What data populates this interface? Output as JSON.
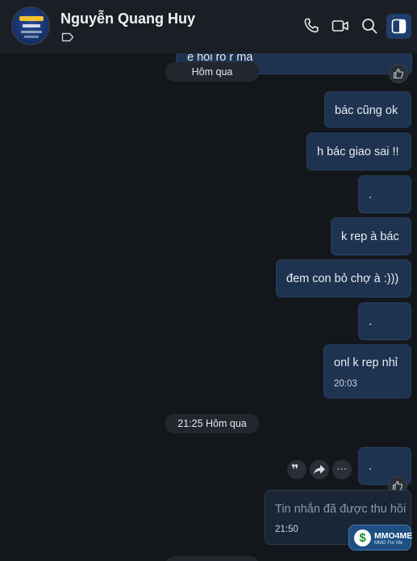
{
  "header": {
    "contact_name": "Nguyễn Quang Huy",
    "icons": [
      "call-icon",
      "video-call-icon",
      "search-icon",
      "panel-toggle-icon",
      "tag-icon"
    ]
  },
  "chat": {
    "partial_top_message": "e hỏi rõ r mà",
    "date_separator": "Hôm qua",
    "messages": [
      {
        "text": "bác cũng ok"
      },
      {
        "text": "h bác giao sai !!"
      },
      {
        "text": "."
      },
      {
        "text": "k rep à bác"
      },
      {
        "text": "đem con bỏ chợ à :)))"
      },
      {
        "text": "."
      },
      {
        "text": "onl k rep nhỉ",
        "time": "20:03"
      }
    ],
    "time_separator": "21:25 Hôm qua",
    "later_message": {
      "text": "."
    },
    "recalled_message": {
      "text": "Tin nhắn đã được thu hồi",
      "time": "21:50"
    }
  },
  "watermark": {
    "brand": "MMO4ME",
    "sub": "MMO For Me"
  },
  "colors": {
    "accent": "#1f3d6d",
    "bubble": "#1e3350",
    "background": "#13171c"
  }
}
